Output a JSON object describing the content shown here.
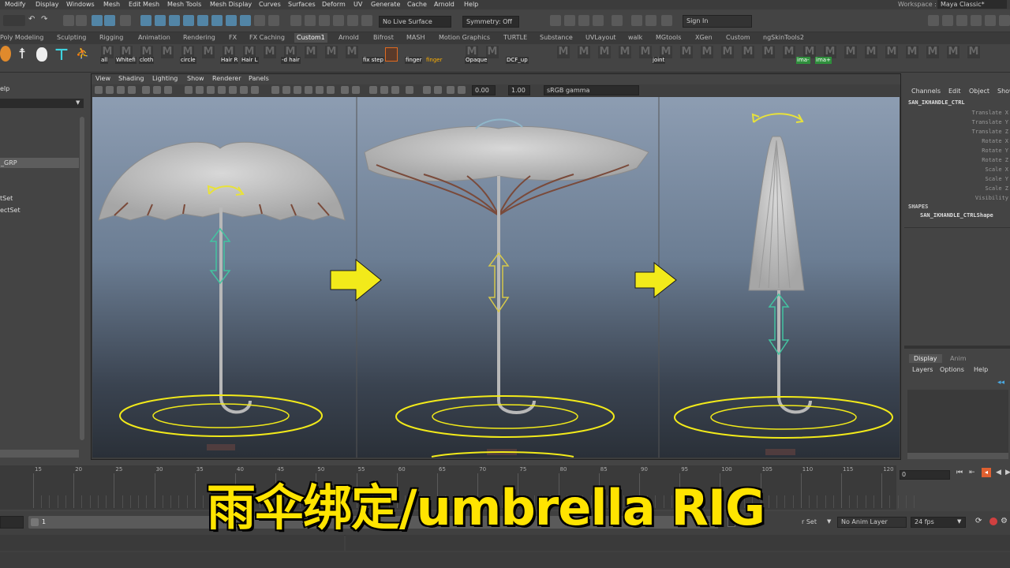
{
  "menu": [
    "Modify",
    "Display",
    "Windows",
    "Mesh",
    "Edit Mesh",
    "Mesh Tools",
    "Mesh Display",
    "Curves",
    "Surfaces",
    "Deform",
    "UV",
    "Generate",
    "Cache",
    "Arnold",
    "Help"
  ],
  "workspace": {
    "label": "Workspace :",
    "value": "Maya Classic*"
  },
  "toolbar": {
    "live_surface": "No Live Surface",
    "symmetry": "Symmetry: Off",
    "sign_in": "Sign In"
  },
  "shelf_tabs": [
    "Poly Modeling",
    "Sculpting",
    "Rigging",
    "Animation",
    "Rendering",
    "FX",
    "FX Caching",
    "Custom1",
    "Arnold",
    "Bifrost",
    "MASH",
    "Motion Graphics",
    "TURTLE",
    "Substance",
    "UVLayout",
    "walk",
    "MGtools",
    "XGen",
    "Custom",
    "ngSkinTools2"
  ],
  "active_shelf_tab": "Custom1",
  "shelf_labels": {
    "all": "all",
    "whitefi": "Whitefi",
    "cloth": "cloth",
    "circle": "circle",
    "hair_r": "Hair R",
    "hair_l": "Hair L",
    "d_hair": "-d hair",
    "fix_step": "fix step",
    "finger1": "finger",
    "finger2": "finger",
    "opaque": "Opaque",
    "dcf_up": "DCF_up",
    "joint": "joint",
    "ima_minus": "ima-",
    "ima_plus": "ima+"
  },
  "left_panel": {
    "help": "elp",
    "items": [
      "_GRP",
      "tSet",
      "ectSet"
    ]
  },
  "viewport_menu": [
    "View",
    "Shading",
    "Lighting",
    "Show",
    "Renderer",
    "Panels"
  ],
  "viewport_toolbar": {
    "value1": "0.00",
    "value2": "1.00",
    "color_space": "sRGB gamma"
  },
  "channel_box": {
    "menu": [
      "Channels",
      "Edit",
      "Object",
      "Show"
    ],
    "object": "SAN_IKHANDLE_CTRL",
    "attributes": [
      "Translate X",
      "Translate Y",
      "Translate Z",
      "Rotate X",
      "Rotate Y",
      "Rotate Z",
      "Scale X",
      "Scale Y",
      "Scale Z",
      "Visibility"
    ],
    "shapes_label": "SHAPES",
    "shape": "SAN_IKHANDLE_CTRLShape"
  },
  "layer_editor": {
    "tabs": [
      "Display",
      "Anim"
    ],
    "menu": [
      "Layers",
      "Options",
      "Help"
    ]
  },
  "timeline": {
    "ticks": [
      "15",
      "20",
      "25",
      "30",
      "35",
      "40",
      "45",
      "50",
      "55",
      "60",
      "65",
      "70",
      "75",
      "80",
      "85",
      "90",
      "95",
      "100",
      "105",
      "110",
      "115",
      "120"
    ],
    "current_frame": "0"
  },
  "range": {
    "start": "1",
    "char_set": "r Set",
    "anim_layer": "No Anim Layer",
    "fps": "24 fps"
  },
  "caption": "雨伞绑定/umbrella RIG"
}
